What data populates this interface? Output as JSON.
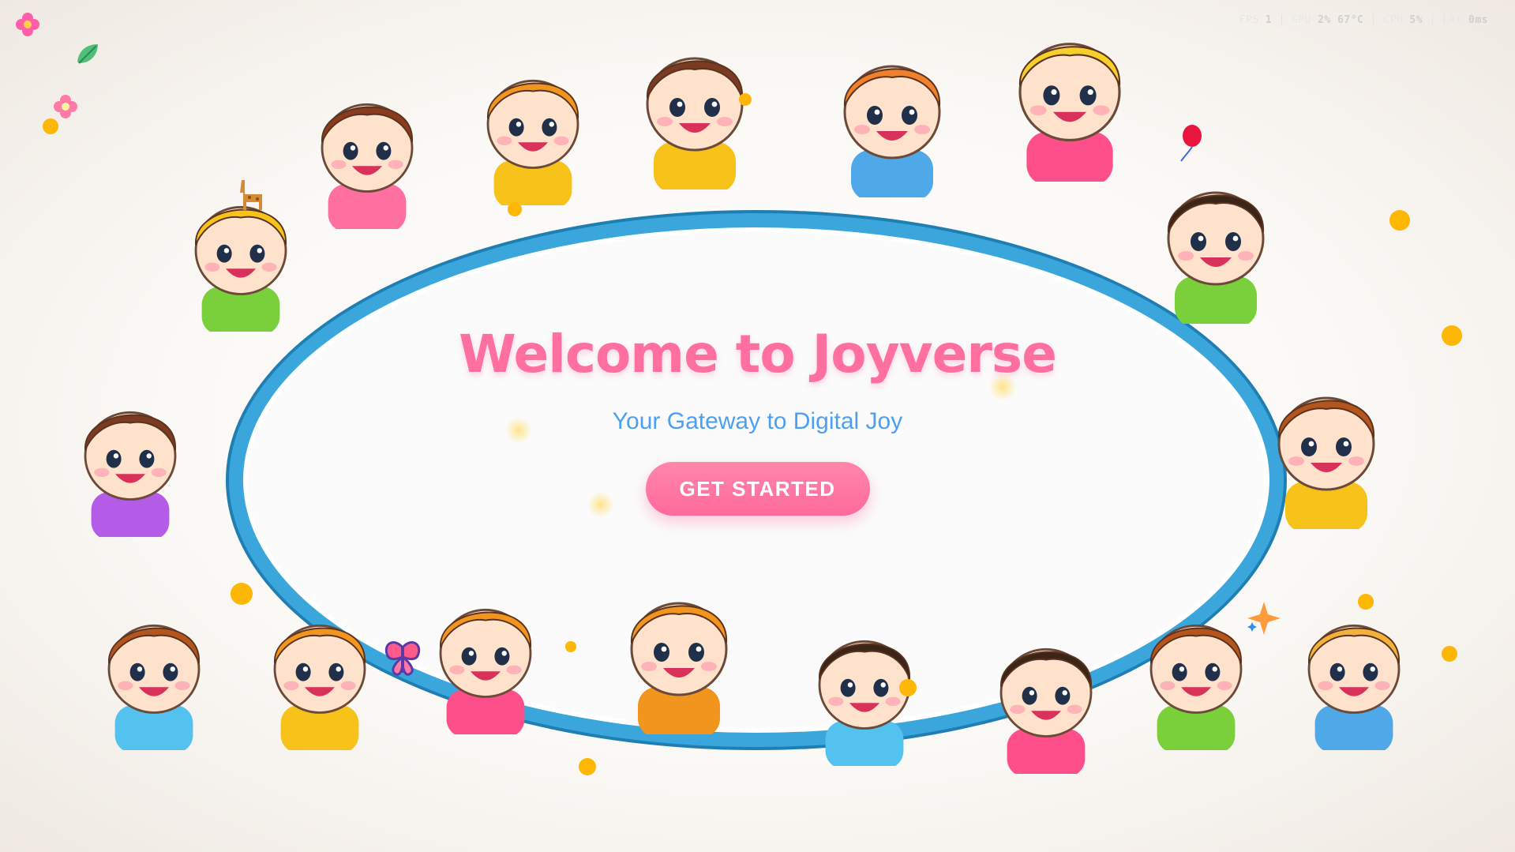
{
  "hud": {
    "fps_label": "FPS",
    "fps_value": "1",
    "gpu_label": "GPU",
    "gpu_value": "2% 67°C",
    "cpu_label": "CPU",
    "cpu_value": "5%",
    "lat_label": "LAT",
    "lat_value": "0ms"
  },
  "hero": {
    "title": "Welcome to Joyverse",
    "subtitle": "Your Gateway to Digital Joy",
    "cta_label": "GET STARTED"
  },
  "colors": {
    "title_pink": "#ff6f9f",
    "subtitle_blue": "#4d9ff0",
    "cta_pink": "#ff6a9b",
    "frame_blue": "#3aa6dc",
    "confetti_yellow": "#ffb705"
  },
  "decor": {
    "icons": [
      "flower-icon",
      "leaf-icon",
      "giraffe-icon",
      "butterfly-icon",
      "balloon-icon",
      "sparkle-icon"
    ]
  }
}
